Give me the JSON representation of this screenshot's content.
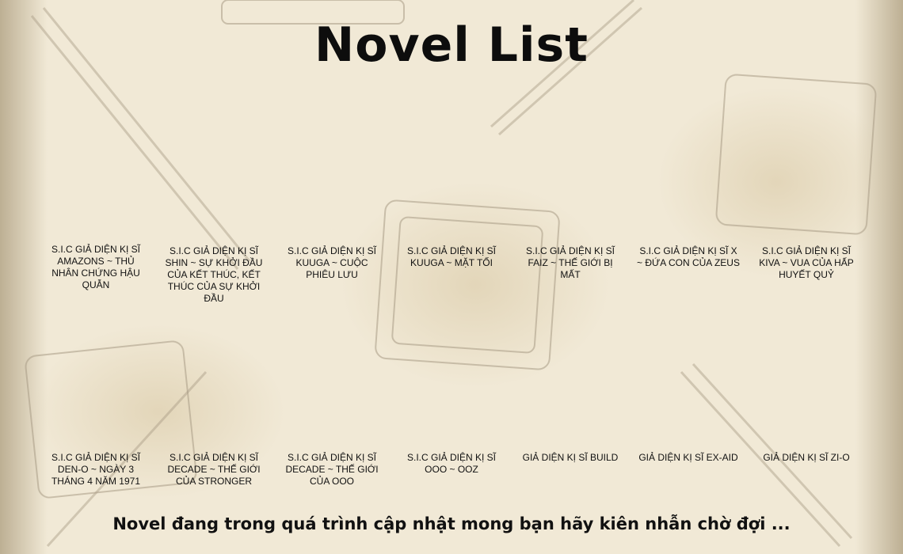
{
  "page": {
    "title": "Novel List",
    "footer": "Novel đang trong quá trình cập nhật mong bạn hãy kiên nhẫn chờ đợi ..."
  },
  "novels": [
    "S.I.C GIẢ DIỆN KỊ SĨ AMAZONS ~ THỦ NHÂN CHỨNG HẬU QUẪN",
    "S.I.C GIẢ DIỆN KỊ SĨ SHIN ~ SỰ KHỞI ĐẦU CỦA KẾT THÚC, KẾT THÚC CỦA SỰ KHỞI ĐẦU",
    "S.I.C GIẢ DIỆN KỊ SĨ KUUGA ~ CUỘC PHIÊU LƯU",
    "S.I.C GIẢ DIỆN KỊ SĨ KUUGA ~ MẶT TỐI",
    "S.I.C GIẢ DIỆN KỊ SĨ FAIZ ~ THẾ GIỚI BỊ MẤT",
    "S.I.C GIẢ DIỆN KỊ SĨ X ~ ĐỨA CON CỦA ZEUS",
    "S.I.C GIẢ DIỆN KỊ SĨ KIVA ~ VUA CỦA HẤP HUYẾT QUỶ",
    "S.I.C GIẢ DIỆN KỊ SĨ DEN-O ~ NGÀY 3 THÁNG 4 NĂM 1971",
    "S.I.C GIẢ DIỆN KỊ SĨ DECADE ~ THẾ GIỚI CỦA STRONGER",
    "S.I.C GIẢ DIỆN KỊ SĨ DECADE ~ THẾ GIỚI CỦA OOO",
    "S.I.C GIẢ DIỆN KỊ SĨ OOO ~ OOZ",
    "GIẢ DIỆN KỊ SĨ BUILD",
    "GIẢ DIỆN KỊ SĨ EX-AID",
    "GIẢ DIỆN KỊ SĨ ZI-O"
  ],
  "colors": {
    "background": "#f1e9d6",
    "text": "#111111",
    "sketch": "#a89c86"
  }
}
